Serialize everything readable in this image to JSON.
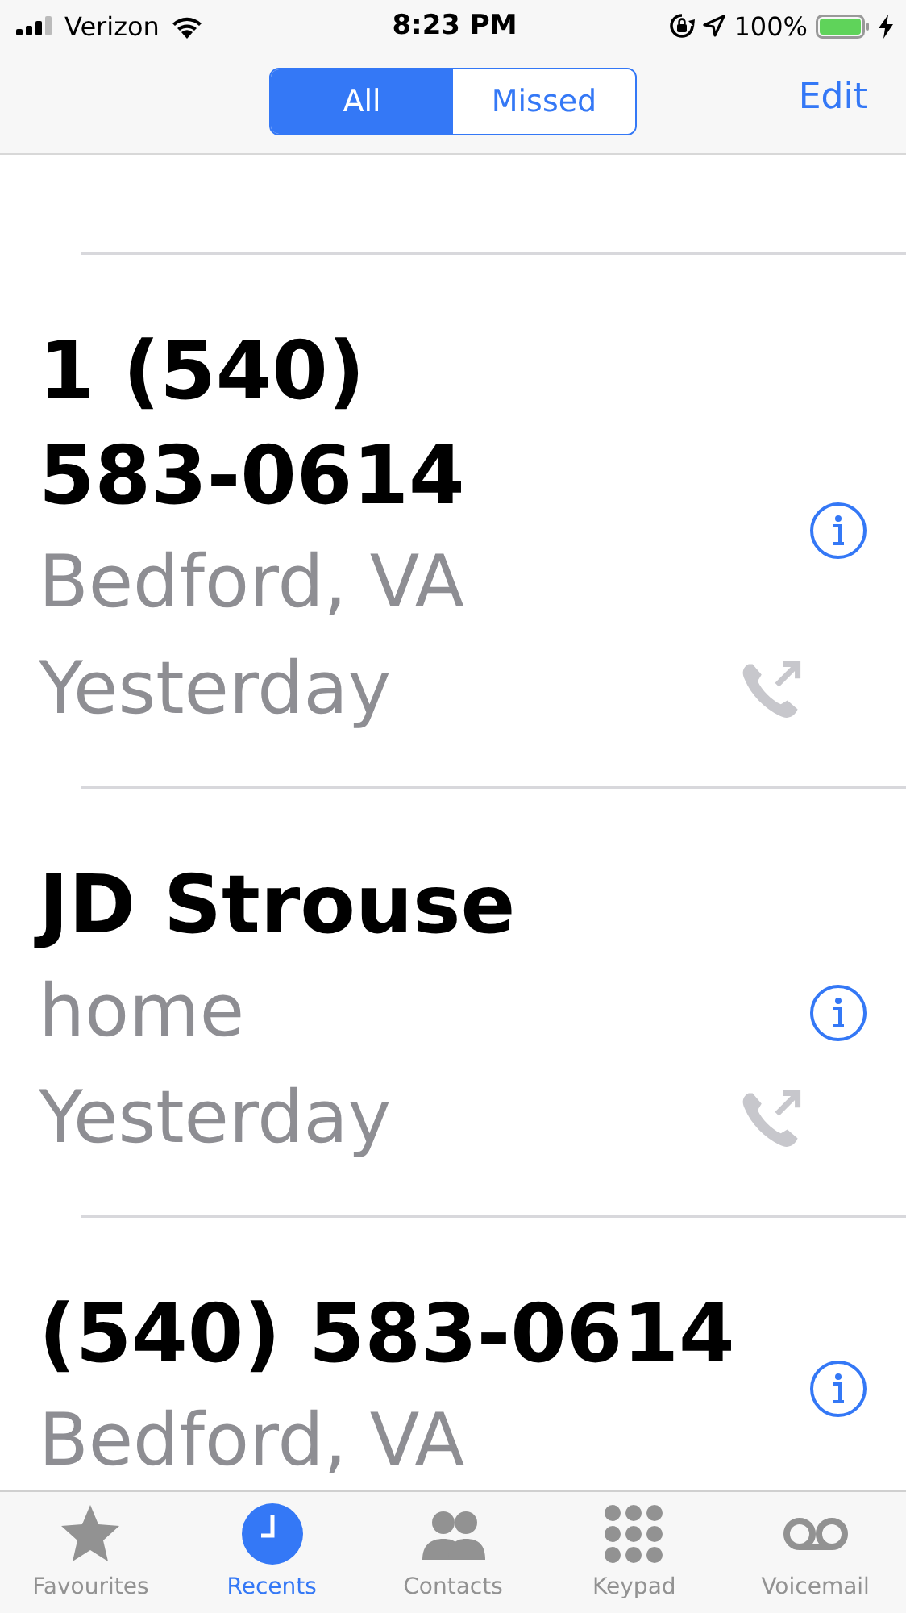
{
  "status_bar": {
    "carrier": "Verizon",
    "time": "8:23 PM",
    "battery": "100%"
  },
  "segments": [
    {
      "label": "All",
      "selected": true
    },
    {
      "label": "Missed",
      "selected": false
    }
  ],
  "edit": "Edit",
  "calls": [
    {
      "name": "1 (540) 583-0614",
      "detail": "Bedford, VA",
      "date": "Yesterday",
      "outgoing": true
    },
    {
      "name": "JD Strouse",
      "detail": "home",
      "date": "Yesterday",
      "outgoing": true
    },
    {
      "name": "(540) 583-0614",
      "detail": "Bedford, VA"
    }
  ],
  "tabs": [
    {
      "label": "Favourites",
      "kind": "star",
      "selected": false
    },
    {
      "label": "Recents",
      "kind": "clock",
      "selected": true
    },
    {
      "label": "Contacts",
      "kind": "people",
      "selected": false
    },
    {
      "label": "Keypad",
      "kind": "keypad",
      "selected": false
    },
    {
      "label": "Voicemail",
      "kind": "voicemail",
      "selected": false
    }
  ]
}
